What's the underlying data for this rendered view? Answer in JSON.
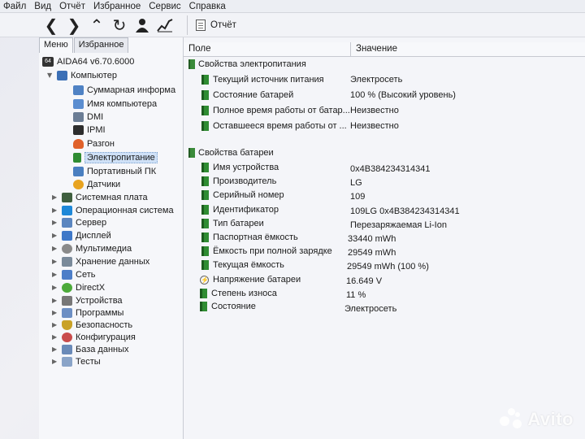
{
  "menu": [
    "Файл",
    "Вид",
    "Отчёт",
    "Избранное",
    "Сервис",
    "Справка"
  ],
  "toolbar": {
    "buttons": [
      "back",
      "forward",
      "up",
      "refresh",
      "user",
      "chart"
    ],
    "report_label": "Отчёт"
  },
  "tabs": [
    "Меню",
    "Избранное"
  ],
  "tree": {
    "app": "AIDA64 v6.70.6000",
    "computer": "Компьютер",
    "computer_children": [
      "Суммарная информа",
      "Имя компьютера",
      "DMI",
      "IPMI",
      "Разгон",
      "Электропитание",
      "Портативный ПК",
      "Датчики"
    ],
    "selected": "Электропитание",
    "top_items": [
      "Системная плата",
      "Операционная система",
      "Сервер",
      "Дисплей",
      "Мультимедиа",
      "Хранение данных",
      "Сеть",
      "DirectX",
      "Устройства",
      "Программы",
      "Безопасность",
      "Конфигурация",
      "База данных",
      "Тесты"
    ]
  },
  "columns": {
    "field": "Поле",
    "value": "Значение"
  },
  "sections": [
    {
      "title": "Свойства электропитания",
      "rows": [
        {
          "field": "Текущий источник питания",
          "value": "Электросеть"
        },
        {
          "field": "Состояние батарей",
          "value": "100 % (Высокий уровень)"
        },
        {
          "field": "Полное время работы от батар...",
          "value": "Неизвестно"
        },
        {
          "field": "Оставшееся время работы от ...",
          "value": "Неизвестно"
        }
      ]
    },
    {
      "title": "Свойства батареи",
      "rows": [
        {
          "field": "Имя устройства",
          "value": "0x4B384234314341"
        },
        {
          "field": "Производитель",
          "value": "LG"
        },
        {
          "field": "Серийный номер",
          "value": "109"
        },
        {
          "field": "Идентификатор",
          "value": "109LG 0x4B384234314341"
        },
        {
          "field": "Тип батареи",
          "value": "Перезаряжаемая Li-Ion"
        },
        {
          "field": "Паспортная ёмкость",
          "value": "33440 mWh"
        },
        {
          "field": "Ёмкость при полной зарядке",
          "value": "29549 mWh"
        },
        {
          "field": "Текущая ёмкость",
          "value": "29549 mWh  (100 %)"
        },
        {
          "field": "Напряжение батареи",
          "value": "16.649 V"
        },
        {
          "field": "Степень износа",
          "value": "11 %"
        },
        {
          "field": "Состояние",
          "value": "Электросеть"
        }
      ]
    }
  ],
  "watermark": "Avito",
  "colors": {
    "accent": "#2f8c32",
    "selection": "#cfe1f7"
  }
}
